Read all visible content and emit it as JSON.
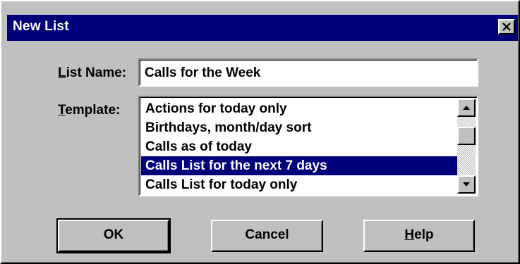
{
  "dialog": {
    "title": "New List"
  },
  "fields": {
    "list_name": {
      "label_mnemonic": "L",
      "label_rest": "ist Name:",
      "value": "Calls for the Week"
    },
    "template": {
      "label_mnemonic": "T",
      "label_rest": "emplate:",
      "items": [
        "Actions for today only",
        "Birthdays, month/day sort",
        "Calls as of today",
        "Calls List for the next 7 days",
        "Calls List for today only"
      ],
      "selected_index": 3
    }
  },
  "buttons": {
    "ok": "OK",
    "cancel": "Cancel",
    "help_mnemonic": "H",
    "help_rest": "elp"
  },
  "icons": {
    "close": "close-icon",
    "scroll_up": "arrow-up-icon",
    "scroll_down": "arrow-down-icon"
  },
  "colors": {
    "titlebar": "#00007b",
    "selection": "#00007b",
    "face": "#c0c0c0"
  }
}
